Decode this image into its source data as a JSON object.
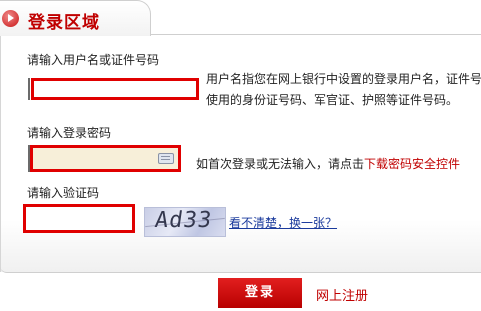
{
  "header": {
    "title": "登录区域"
  },
  "username": {
    "label": "请输入用户名或证件号码",
    "value": "",
    "hint_line1": "用户名指您在网上银行中设置的登录用户名，证件号",
    "hint_line2": "使用的身份证号码、军官证、护照等证件号码。"
  },
  "password": {
    "label": "请输入登录密码",
    "value": "",
    "hint_prefix": "如首次登录或无法输入，请点击",
    "hint_link": "下载密码安全控件"
  },
  "captcha": {
    "label": "请输入验证码",
    "value": "",
    "image_text": "Ad33",
    "refresh_link": "看不清楚，换一张？"
  },
  "actions": {
    "login_label": "登录",
    "register_label": "网上注册"
  },
  "colors": {
    "accent": "#c00000",
    "field_border": "#e00000",
    "link_blue": "#1a3a9c"
  }
}
